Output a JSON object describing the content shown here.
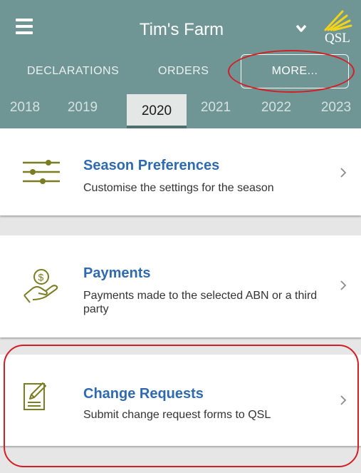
{
  "header": {
    "farm_name": "Tim's Farm",
    "logo_text": "QSL"
  },
  "nav": {
    "declarations": "DECLARATIONS",
    "orders": "ORDERS",
    "more": "MORE..."
  },
  "years": {
    "items": [
      "2018",
      "2019",
      "2020",
      "2021",
      "2022",
      "2023"
    ],
    "selected": "2020"
  },
  "cards": {
    "season": {
      "title": "Season Preferences",
      "description": "Customise the settings for the season"
    },
    "payments": {
      "title": "Payments",
      "description": "Payments made to the selected ABN or a third party"
    },
    "change": {
      "title": "Change Requests",
      "description": "Submit change request forms to QSL"
    }
  },
  "colors": {
    "header_bg": "#6f9694",
    "title_blue": "#2f6ab0",
    "icon_olive": "#7b7d22",
    "annotation_red": "#d21f25"
  }
}
